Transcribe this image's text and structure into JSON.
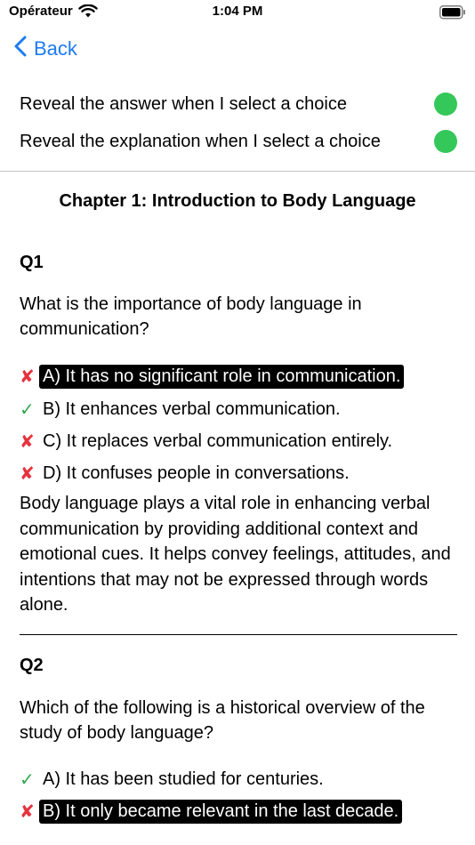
{
  "status": {
    "carrier": "Opérateur",
    "time": "1:04 PM"
  },
  "nav": {
    "back_label": "Back"
  },
  "settings": {
    "reveal_answer": "Reveal the answer when I select a choice",
    "reveal_explanation": "Reveal the explanation when I select a choice"
  },
  "chapter": {
    "title": "Chapter 1: Introduction to Body Language"
  },
  "questions": [
    {
      "label": "Q1",
      "text": "What is the importance of body language in communication?",
      "choices": [
        {
          "mark": "✘",
          "text": "A) It has no significant role in communication."
        },
        {
          "mark": "✓",
          "text": "B) It enhances verbal communication."
        },
        {
          "mark": "✘",
          "text": "C) It replaces verbal communication entirely."
        },
        {
          "mark": "✘",
          "text": "D) It confuses people in conversations."
        }
      ],
      "explanation": "Body language plays a vital role in enhancing verbal communication by providing additional context and emotional cues. It helps convey feelings, attitudes, and intentions that may not be expressed through words alone."
    },
    {
      "label": "Q2",
      "text": "Which of the following is a historical overview of the study of body language?",
      "choices": [
        {
          "mark": "✓",
          "text": "A) It has been studied for centuries."
        },
        {
          "mark": "✘",
          "text": "B) It only became relevant in the last decade."
        }
      ]
    }
  ],
  "colors": {
    "accent": "#1d7bf2",
    "toggle_on": "#34c759",
    "wrong": "#e5333d",
    "correct": "#34a853"
  }
}
